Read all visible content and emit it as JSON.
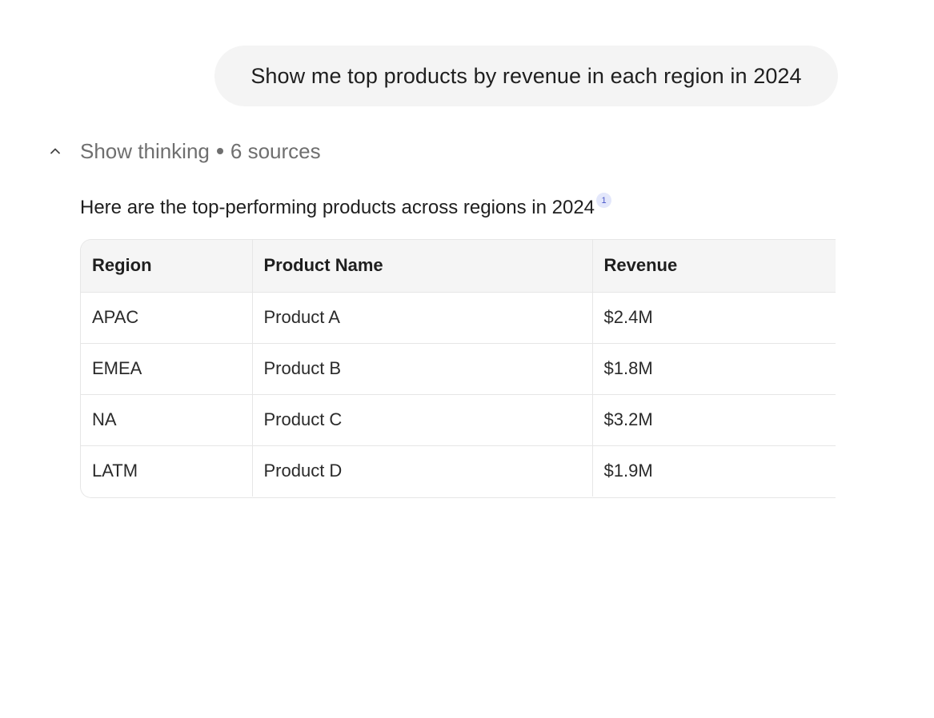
{
  "user_message": {
    "text": "Show me top products by revenue in each region in 2024"
  },
  "thinking": {
    "label": "Show thinking",
    "sources": "6 sources",
    "toggle_icon": "chevron-up-icon"
  },
  "response": {
    "intro": "Here are the top-performing products across regions in 2024",
    "citation": "1"
  },
  "table": {
    "headers": [
      "Region",
      "Product Name",
      "Revenue"
    ],
    "rows": [
      [
        "APAC",
        "Product A",
        "$2.4M"
      ],
      [
        "EMEA",
        "Product B",
        "$1.8M"
      ],
      [
        "NA",
        "Product C",
        "$3.2M"
      ],
      [
        "LATM",
        "Product D",
        "$1.9M"
      ]
    ]
  }
}
